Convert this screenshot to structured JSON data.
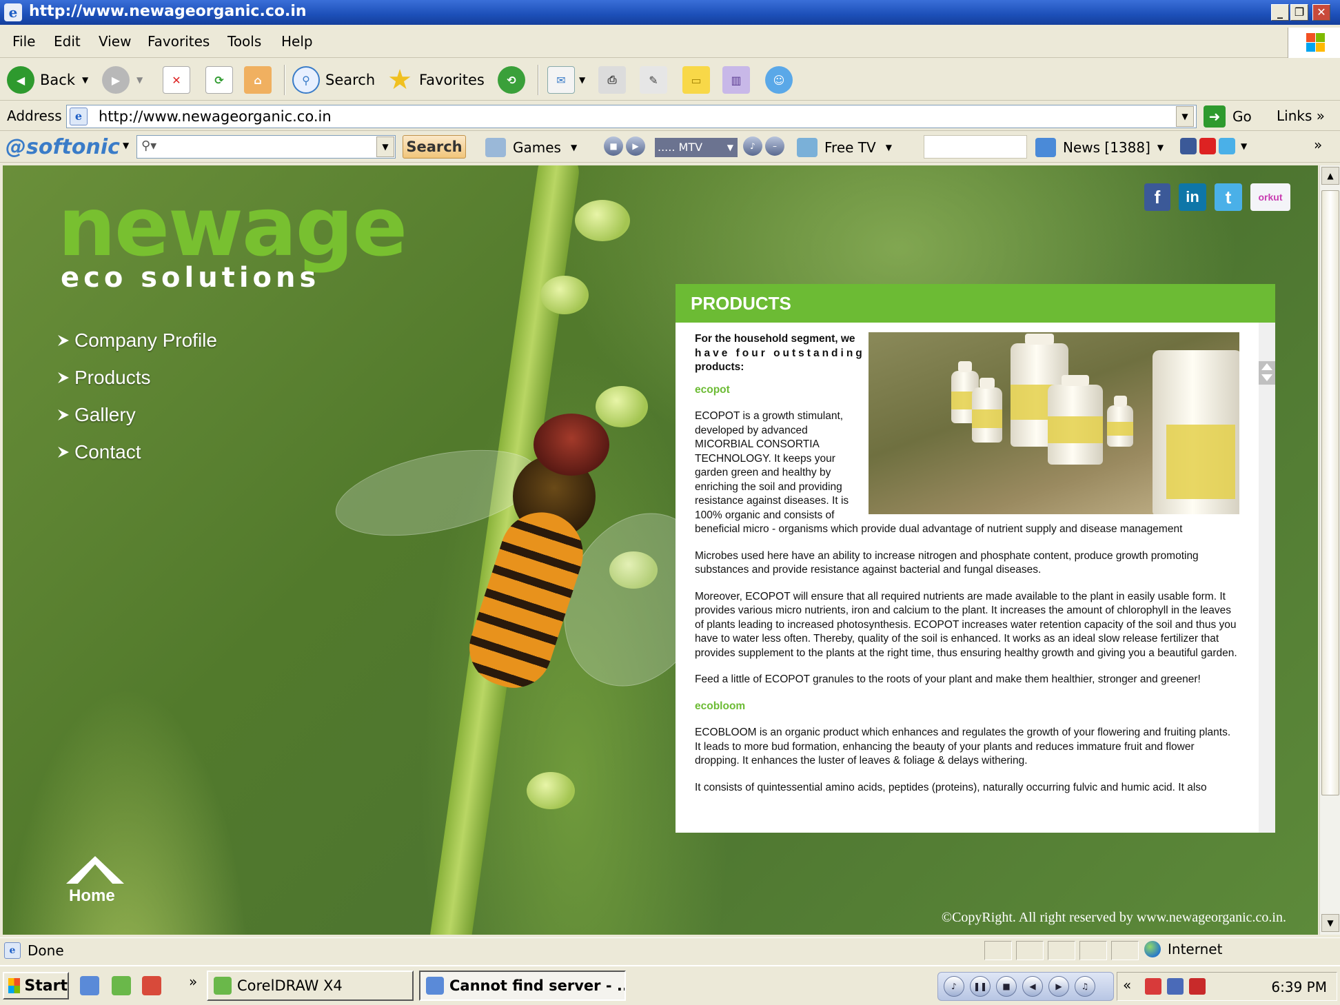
{
  "window": {
    "title": "http://www.newageorganic.co.in",
    "buttons": {
      "minimize": "_",
      "maximize": "❐",
      "close": "✕"
    }
  },
  "menu": [
    "File",
    "Edit",
    "View",
    "Favorites",
    "Tools",
    "Help"
  ],
  "toolbar": {
    "back": "Back",
    "search": "Search",
    "favorites": "Favorites"
  },
  "address": {
    "label": "Address",
    "url": "http://www.newageorganic.co.in",
    "go": "Go",
    "links": "Links"
  },
  "softonic": {
    "logo": "softonic",
    "search_button": "Search",
    "games": "Games",
    "mtv": "..... MTV",
    "free_tv": "Free TV",
    "news": "News [1388]"
  },
  "site": {
    "logo_main": "newage",
    "logo_sub": "eco solutions",
    "nav": [
      "Company Profile",
      "Products",
      "Gallery",
      "Contact"
    ],
    "home": "Home",
    "copyright": "©CopyRight. All right reserved by www.newageorganic.co.in.",
    "social": [
      "facebook",
      "linkedin",
      "twitter",
      "orkut"
    ]
  },
  "products": {
    "heading": "PRODUCTS",
    "intro": "For the household segment, we have four outstanding products:",
    "intro_line1": "For the household segment, we",
    "intro_line2": "have four outstanding",
    "intro_line3": "products:",
    "sections": [
      {
        "name": "ecopot",
        "paragraphs": [
          "ECOPOT is a growth stimulant, developed by advanced MICORBIAL CONSORTIA TECHNOLOGY. It keeps your garden green and healthy by enriching the soil and providing resistance against diseases. It is 100% organic and consists of beneficial micro - organisms which provide dual advantage of nutrient supply and disease management",
          "Microbes used here have an ability to increase nitrogen and phosphate content, produce growth promoting substances and provide resistance against bacterial and fungal diseases.",
          "Moreover, ECOPOT will ensure that all required nutrients are made available to the plant in easily usable form. It provides various micro nutrients, iron and calcium to the plant. It increases the amount of chlorophyll in the leaves of plants leading to increased photosynthesis. ECOPOT increases water retention capacity of the soil and thus you have to water less often. Thereby, quality of the soil is enhanced. It works as an ideal slow release fertilizer that provides supplement to the plants at the right time, thus ensuring healthy growth and giving you a beautiful garden.",
          "Feed a little of ECOPOT granules to the roots of your plant and make them healthier, stronger and greener!"
        ]
      },
      {
        "name": "ecobloom",
        "paragraphs": [
          "ECOBLOOM is an organic product which enhances and regulates the growth of your flowering and fruiting plants. It leads to more bud formation, enhancing the beauty of your plants and reduces immature fruit and flower dropping. It enhances the luster of leaves & foliage & delays withering.",
          "It consists of quintessential amino acids, peptides (proteins), naturally occurring fulvic and humic acid. It also"
        ]
      }
    ]
  },
  "status": {
    "text": "Done",
    "zone": "Internet"
  },
  "taskbar": {
    "start": "Start",
    "tasks": [
      "CorelDRAW X4",
      "Cannot find server - ..."
    ],
    "clock": "6:39 PM"
  }
}
